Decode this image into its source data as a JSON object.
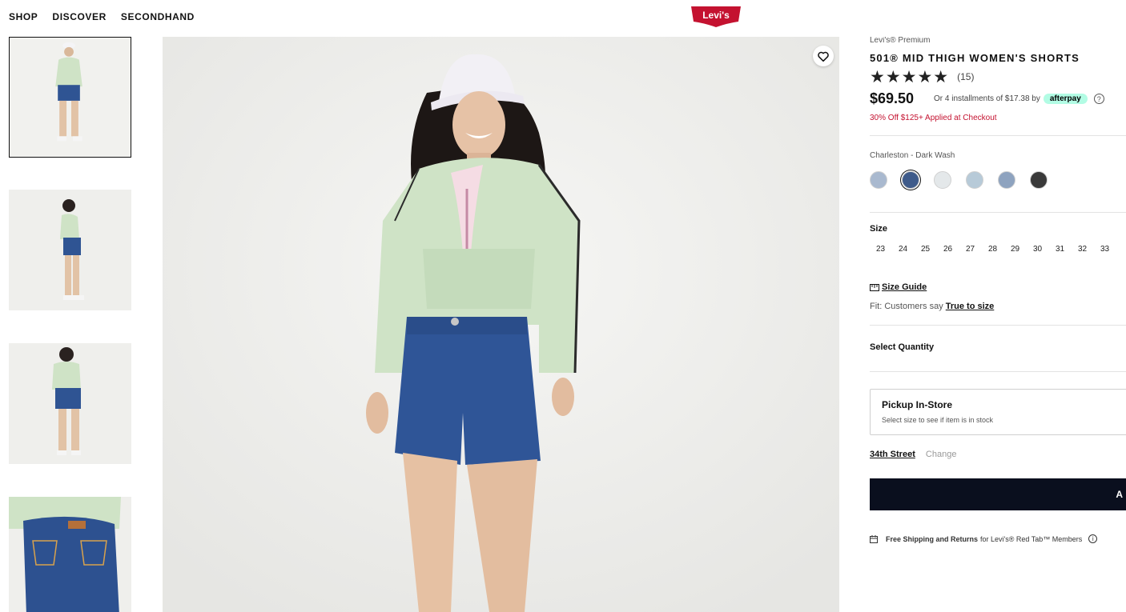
{
  "nav": {
    "items": [
      "SHOP",
      "DISCOVER",
      "SECONDHAND"
    ],
    "logo_text": "Levi's"
  },
  "thumbnails": [
    "front-view",
    "side-view",
    "back-view",
    "back-detail"
  ],
  "product": {
    "brand": "Levi's® Premium",
    "title": "501® MID THIGH WOMEN'S SHORTS",
    "stars": "★★★★★",
    "rating_count": "(15)",
    "price": "$69.50",
    "installments": "Or 4 installments of $17.38 by",
    "afterpay_label": "afterpay",
    "promo": "30% Off $125+ Applied at Checkout",
    "color_name": "Charleston - Dark Wash",
    "swatches": [
      "#a9b9cf",
      "#3f5b8a",
      "#e4e8ea",
      "#b7cad8",
      "#8ea3bf",
      "#3a3a3a"
    ],
    "size_label": "Size",
    "sizes": [
      "23",
      "24",
      "25",
      "26",
      "27",
      "28",
      "29",
      "30",
      "31",
      "32",
      "33"
    ],
    "size_guide": "Size Guide",
    "fit_prefix": "Fit:",
    "fit_text": "Customers say",
    "fit_link": "True to size",
    "qty_label": "Select Quantity",
    "pickup_title": "Pickup In-Store",
    "pickup_sub": "Select size to see if item is in stock",
    "store_name": "34th Street",
    "store_change": "Change",
    "add_button": "A",
    "ship_bold": "Free Shipping and Returns",
    "ship_text": "for Levi's® Red Tab™ Members"
  },
  "colors": {
    "accent_red": "#c41230",
    "button_dark": "#0a0f1e",
    "afterpay_mint": "#b2fce4"
  }
}
